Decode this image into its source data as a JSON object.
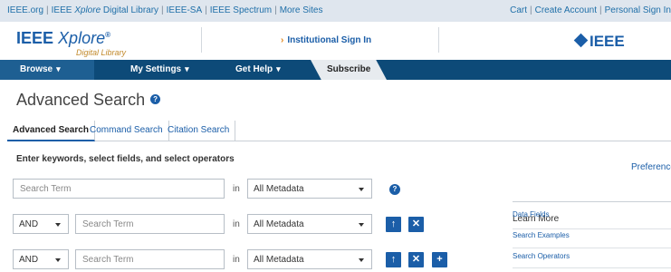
{
  "topbar": {
    "links": [
      "IEEE.org",
      "IEEE",
      "Xplore",
      "Digital Library",
      "IEEE-SA",
      "IEEE Spectrum",
      "More Sites"
    ],
    "right_links": [
      "Cart",
      "Create Account",
      "Personal Sign In"
    ]
  },
  "header": {
    "logo_main_ieee": "IEEE",
    "logo_main_xplore": "Xplore",
    "logo_reg": "®",
    "logo_sub": "Digital Library",
    "institutional_signin": "Institutional Sign In",
    "ieee_logo": "IEEE"
  },
  "nav": {
    "browse": "Browse",
    "settings": "My Settings",
    "help": "Get Help",
    "subscribe": "Subscribe"
  },
  "page": {
    "title": "Advanced Search",
    "help_glyph": "?"
  },
  "tabs": [
    "Advanced Search",
    "Command Search",
    "Citation Search"
  ],
  "form": {
    "instructions": "Enter keywords, select fields, and select operators",
    "preferences": "Preferences",
    "rows": [
      {
        "operator": null,
        "placeholder": "Search Term",
        "in": "in",
        "field": "All Metadata"
      },
      {
        "operator": "AND",
        "placeholder": "Search Term",
        "in": "in",
        "field": "All Metadata"
      },
      {
        "operator": "AND",
        "placeholder": "Search Term",
        "in": "in",
        "field": "All Metadata"
      }
    ]
  },
  "learn_more": {
    "title": "Learn More",
    "links": [
      "Data Fields",
      "Search Examples",
      "Search Operators"
    ]
  },
  "colors": {
    "nav_bg": "#0d4a78",
    "accent": "#1b5ea8",
    "topbar_bg": "#dfe6ee"
  }
}
